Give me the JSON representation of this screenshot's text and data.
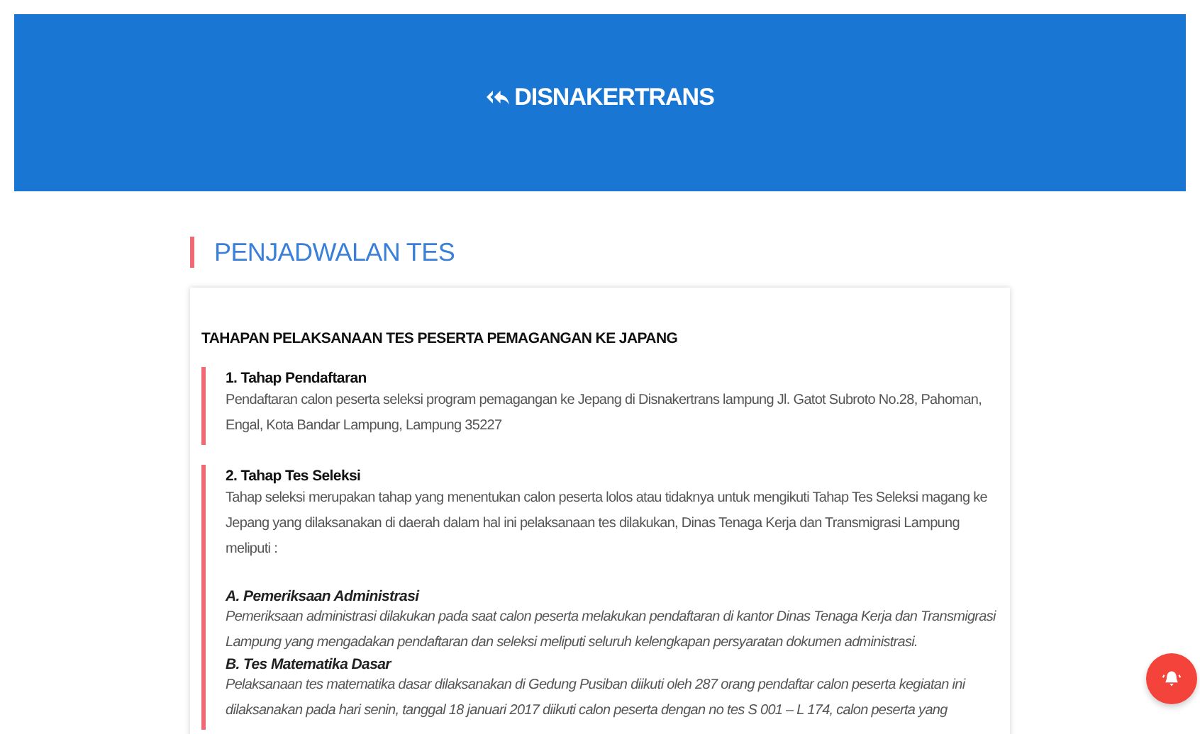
{
  "header": {
    "title": "DISNAKERTRANS"
  },
  "page_title": "PENJADWALAN TES",
  "article": {
    "heading": "TAHAPAN PELAKSANAAN TES PESERTA PEMAGANGAN KE JAPANG",
    "steps": [
      {
        "title": "1. Tahap Pendaftaran",
        "text": "Pendaftaran calon peserta seleksi program pemagangan ke Jepang di Disnakertrans lampung Jl. Gatot Subroto No.28, Pahoman, Engal, Kota Bandar Lampung, Lampung 35227"
      },
      {
        "title": "2. Tahap Tes Seleksi",
        "text": "Tahap seleksi merupakan tahap yang menentukan calon peserta lolos atau tidaknya untuk mengikuti Tahap Tes Seleksi magang ke Jepang yang dilaksanakan di daerah dalam hal ini pelaksanaan tes dilakukan, Dinas Tenaga Kerja dan Transmigrasi Lampung meliputi :",
        "subsections": [
          {
            "title": "A. Pemeriksaan Administrasi",
            "text": "Pemeriksaan administrasi dilakukan pada saat calon peserta melakukan pendaftaran di kantor Dinas Tenaga Kerja dan Transmigrasi Lampung yang mengadakan pendaftaran dan seleksi meliputi seluruh kelengkapan persyaratan dokumen administrasi."
          },
          {
            "title": "B. Tes Matematika Dasar",
            "text": "Pelaksanaan tes matematika dasar dilaksanakan di Gedung Pusiban diikuti oleh 287 orang pendaftar calon peserta kegiatan ini dilaksanakan pada hari senin, tanggal 18 januari 2017 diikuti calon peserta dengan no tes S 001 – L 174, calon peserta yang"
          }
        ]
      }
    ]
  }
}
